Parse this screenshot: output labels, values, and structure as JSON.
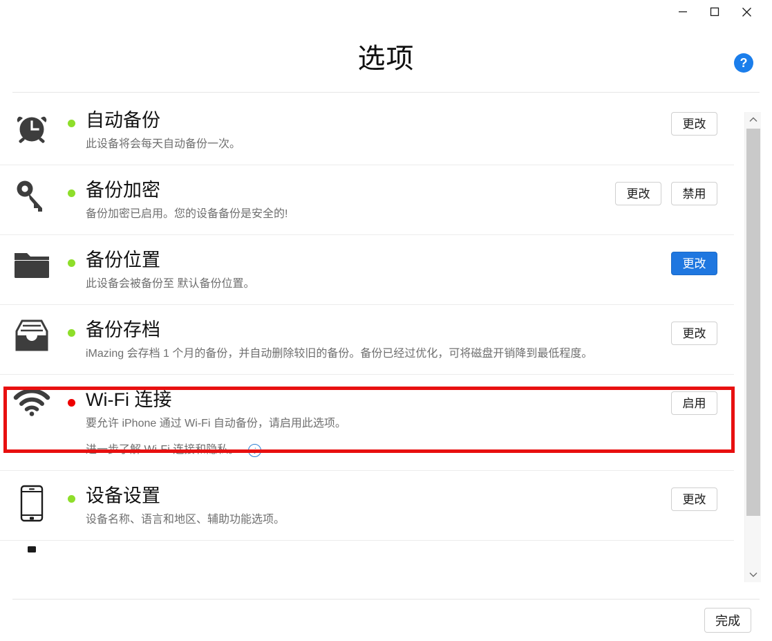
{
  "window": {
    "minimize_label": "—",
    "maximize_label": "□",
    "close_label": "✕"
  },
  "header": {
    "title": "选项",
    "help_label": "?"
  },
  "colors": {
    "accent_blue": "#1f77e0",
    "status_on": "#8ede2a",
    "status_off": "#ee0000",
    "highlight_red": "#e81010",
    "help_blue": "#1b7eeb"
  },
  "rows": [
    {
      "icon": "alarm-clock-icon",
      "status": "on",
      "title": "自动备份",
      "desc": "此设备将会每天自动备份一次。",
      "actions": [
        {
          "label": "更改",
          "style": "default",
          "name": "change-button"
        }
      ]
    },
    {
      "icon": "key-icon",
      "status": "on",
      "title": "备份加密",
      "desc": "备份加密已启用。您的设备备份是安全的!",
      "actions": [
        {
          "label": "更改",
          "style": "default",
          "name": "change-button"
        },
        {
          "label": "禁用",
          "style": "default",
          "name": "disable-button"
        }
      ]
    },
    {
      "icon": "folder-icon",
      "status": "on",
      "title": "备份位置",
      "desc": "此设备会被备份至 默认备份位置。",
      "actions": [
        {
          "label": "更改",
          "style": "primary",
          "name": "change-button"
        }
      ]
    },
    {
      "icon": "archive-tray-icon",
      "status": "on",
      "title": "备份存档",
      "desc": "iMazing 会存档 1 个月的备份，并自动删除较旧的备份。备份已经过优化，可将磁盘开销降到最低程度。",
      "actions": [
        {
          "label": "更改",
          "style": "default",
          "name": "change-button"
        }
      ]
    },
    {
      "icon": "wifi-icon",
      "status": "off",
      "title": "Wi-Fi 连接",
      "desc": "要允许 iPhone 通过 Wi-Fi 自动备份，请启用此选项。",
      "sub": "进一步了解 Wi-Fi 连接和隐私。",
      "sub_icon": "info-icon",
      "highlighted": true,
      "actions": [
        {
          "label": "启用",
          "style": "default",
          "name": "enable-button"
        }
      ]
    },
    {
      "icon": "phone-icon",
      "status": "on",
      "title": "设备设置",
      "desc": "设备名称、语言和地区、辅助功能选项。",
      "actions": [
        {
          "label": "更改",
          "style": "default",
          "name": "change-button"
        }
      ]
    }
  ],
  "scrollbar": {
    "up_label": "⌃",
    "down_label": "⌄"
  },
  "footer": {
    "done_label": "完成"
  }
}
